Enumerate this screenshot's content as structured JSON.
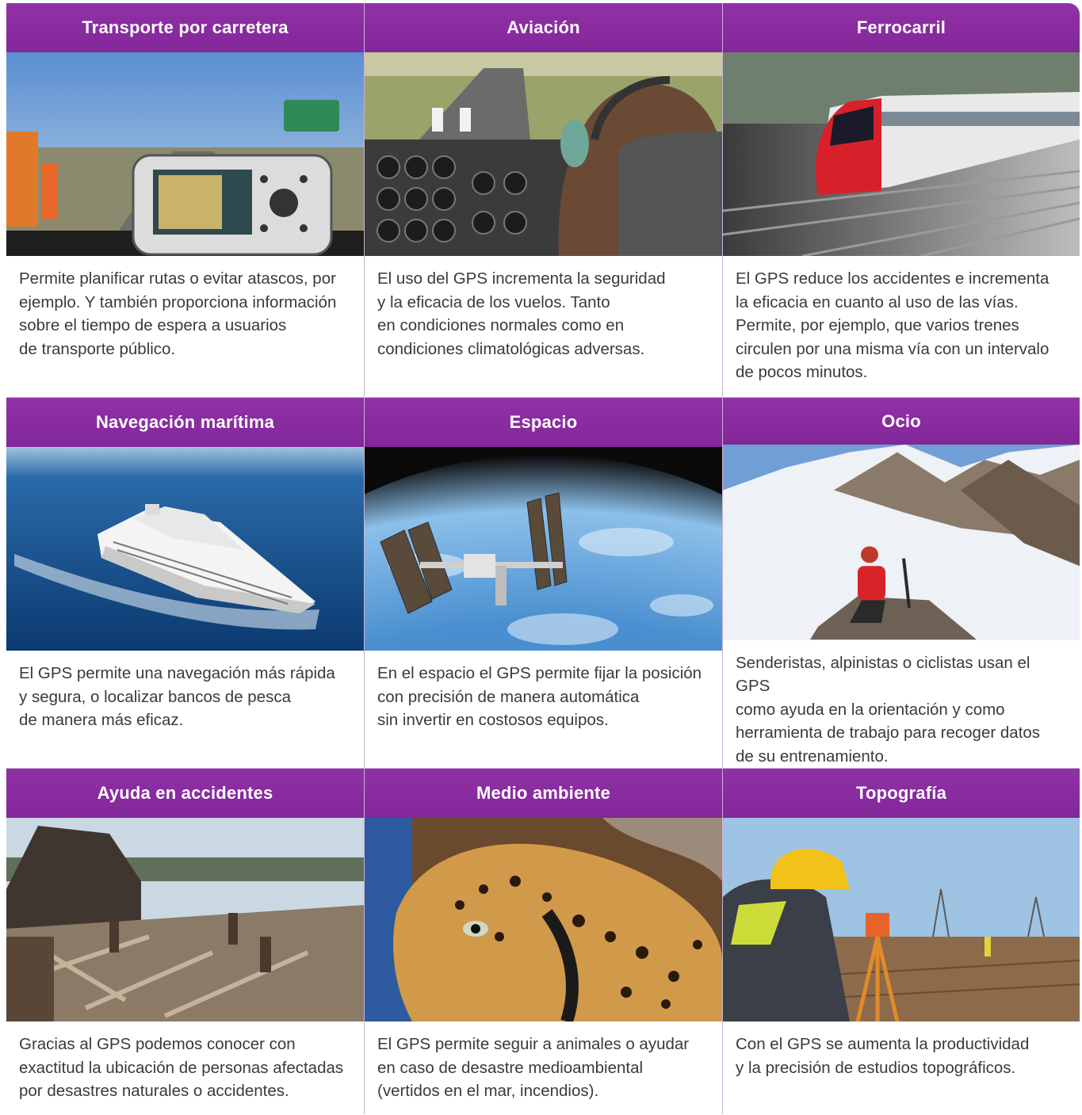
{
  "cards": [
    {
      "title": "Transporte por carretera",
      "text": "Permite planificar rutas o evitar atascos, por\nejemplo. Y también proporciona información\nsobre el tiempo de espera a usuarios\nde transporte público.",
      "image": "gps-car-navigator"
    },
    {
      "title": "Aviación",
      "text": "El uso del GPS incrementa la seguridad\ny la eficacia de los vuelos. Tanto\nen condiciones normales como en\ncondiciones climatológicas adversas.",
      "image": "airplane-cockpit-pilot"
    },
    {
      "title": "Ferrocarril",
      "text": "El GPS reduce los accidentes e incrementa\nla eficacia en cuanto al uso de las vías.\nPermite, por ejemplo, que varios trenes\ncirculen por una misma vía con un intervalo\nde pocos minutos.",
      "image": "high-speed-train"
    },
    {
      "title": "Navegación marítima",
      "text": "El GPS permite una navegación más rápida\ny segura, o localizar bancos de pesca\nde manera más eficaz.",
      "image": "cruise-ship"
    },
    {
      "title": "Espacio",
      "text": "En el espacio el GPS permite fijar la posición\ncon precisión de manera automática\nsin invertir en costosos equipos.",
      "image": "space-station-over-earth"
    },
    {
      "title": "Ocio",
      "text": "Senderistas, alpinistas o ciclistas usan el GPS\ncomo ayuda en la orientación y como\nherramienta de trabajo para recoger datos\nde su entrenamiento.",
      "image": "hiker-on-snowy-mountain"
    },
    {
      "title": "Ayuda en accidentes",
      "text": "Gracias al GPS podemos conocer con\nexactitud la ubicación de personas afectadas\npor desastres naturales o accidentes.",
      "image": "disaster-rubble"
    },
    {
      "title": "Medio ambiente",
      "text": "El GPS permite seguir a animales o ayudar\nen caso de desastre medioambiental\n(vertidos en el mar, incendios).",
      "image": "leopard-with-tracking-collar"
    },
    {
      "title": "Topografía",
      "text": "Con el GPS se aumenta la productividad\ny la precisión de estudios topográficos.",
      "image": "surveyor-with-theodolite"
    }
  ],
  "colors": {
    "header": "#8a2b9e",
    "header_text": "#ffffff",
    "body_text": "#3a3a3a",
    "divider": "#c9b3d3"
  }
}
